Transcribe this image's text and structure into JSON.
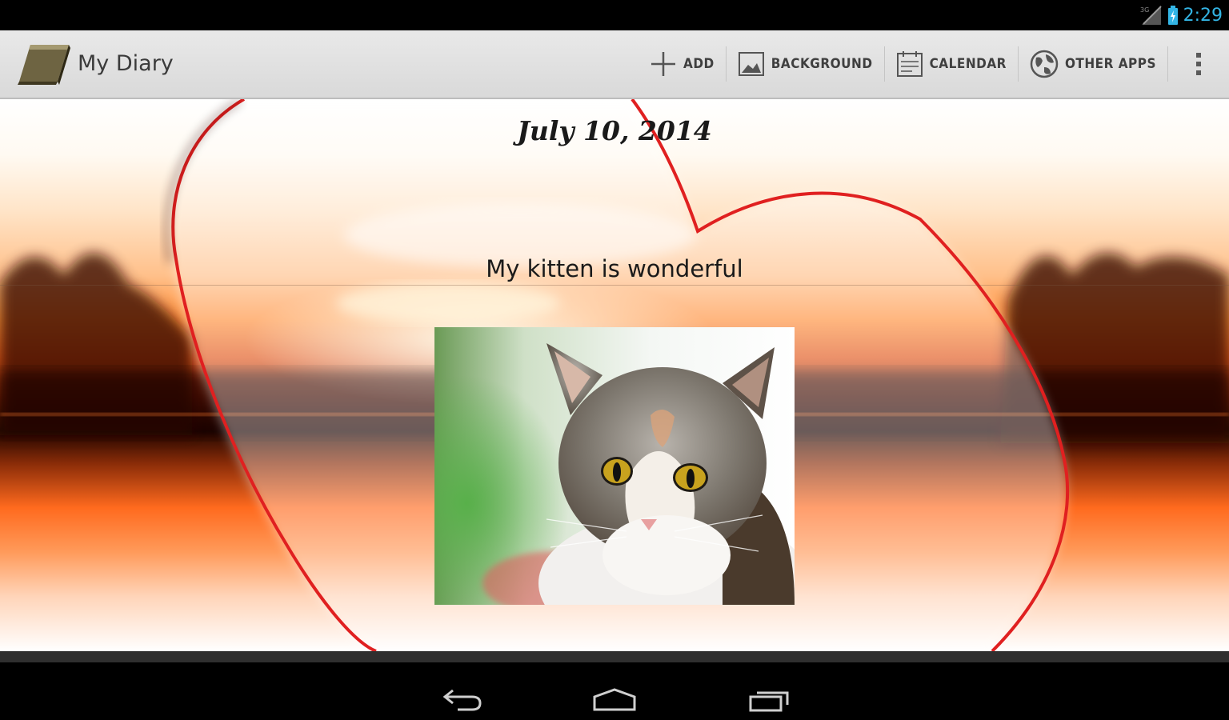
{
  "status_bar": {
    "time": "2:29",
    "signal_label": "3G"
  },
  "action_bar": {
    "title": "My Diary",
    "actions": [
      {
        "label": "ADD",
        "icon": "plus-icon"
      },
      {
        "label": "BACKGROUND",
        "icon": "image-icon"
      },
      {
        "label": "CALENDAR",
        "icon": "calendar-icon"
      },
      {
        "label": "OTHER APPS",
        "icon": "globe-icon"
      }
    ],
    "overflow_icon": "overflow-menu-icon"
  },
  "entry": {
    "date": "July 10, 2014",
    "text": "My kitten is wonderful",
    "photo_icon": "kitten-photo"
  },
  "nav_bar": {
    "buttons": [
      "back-icon",
      "home-icon",
      "recent-apps-icon"
    ]
  },
  "colors": {
    "accent": "#33b5e5",
    "heart_stroke": "#e02020",
    "actionbar": "#e2e2e2"
  }
}
